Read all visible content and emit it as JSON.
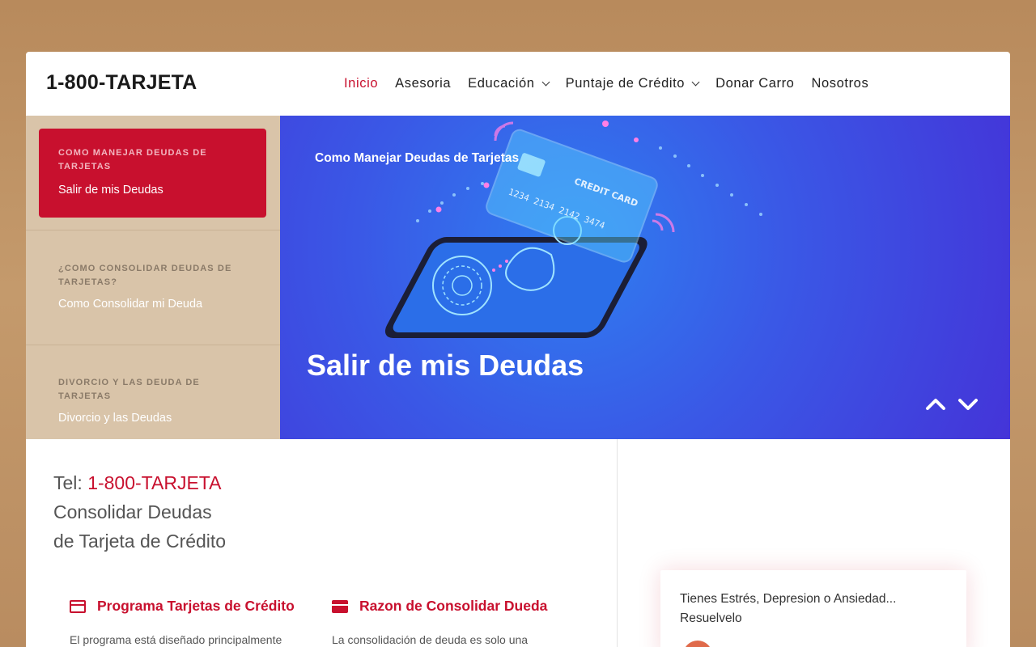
{
  "header": {
    "logo": "1-800-TARJETA",
    "nav": [
      {
        "label": "Inicio",
        "active": true,
        "dropdown": false
      },
      {
        "label": "Asesoria",
        "active": false,
        "dropdown": false
      },
      {
        "label": "Educación",
        "active": false,
        "dropdown": true
      },
      {
        "label": "Puntaje de Crédito",
        "active": false,
        "dropdown": true
      },
      {
        "label": "Donar Carro",
        "active": false,
        "dropdown": false
      },
      {
        "label": "Nosotros",
        "active": false,
        "dropdown": false
      }
    ]
  },
  "slider": {
    "items": [
      {
        "kicker": "COMO MANEJAR DEUDAS DE TARJETAS",
        "title": "Salir de mis Deudas",
        "active": true
      },
      {
        "kicker": "¿COMO CONSOLIDAR DEUDAS DE TARJETAS?",
        "title": "Como Consolidar mi Deuda",
        "active": false
      },
      {
        "kicker": "DIVORCIO Y LAS DEUDA DE TARJETAS",
        "title": "Divorcio y las Deudas",
        "active": false
      }
    ],
    "banner": {
      "category": "Como Manejar Deudas de Tarjetas",
      "headline": "Salir de mis Deudas",
      "card_text": "CREDIT CARD",
      "card_number": "1234 2134 2142 3474"
    }
  },
  "main": {
    "tel_label": "Tel: ",
    "tel_number": "1-800-TARJETA",
    "line2": "Consolidar Deudas",
    "line3": "de Tarjeta de Crédito",
    "features": [
      {
        "icon": "credit-card-icon",
        "title": "Programa Tarjetas de Crédito",
        "desc": "El programa está diseñado principalmente"
      },
      {
        "icon": "credit-card-icon",
        "title": "Razon de Consolidar Dueda",
        "desc": "La consolidación de deuda es solo una"
      }
    ]
  },
  "promo": {
    "text": "Tienes Estrés, Depresion o Ansiedad... Resuelvelo"
  },
  "colors": {
    "accent": "#c8102e",
    "sidebar": "#d9c4a9",
    "banner_blue": "#3a58e6"
  }
}
